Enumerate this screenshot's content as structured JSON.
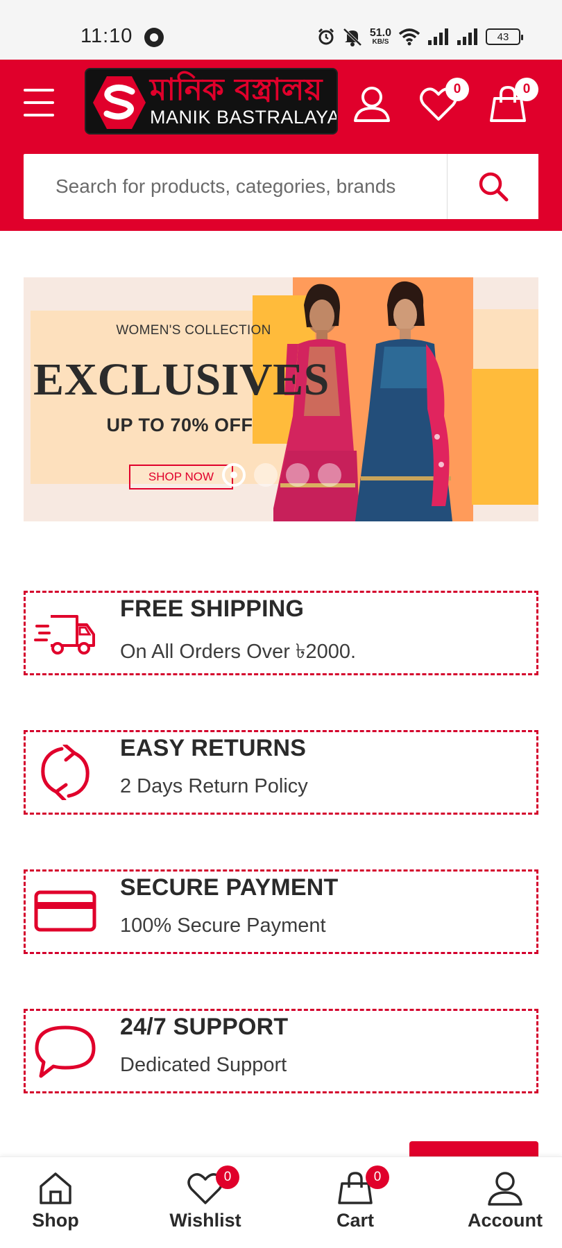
{
  "status_bar": {
    "time": "11:10",
    "net_speed_value": "51.0",
    "net_speed_unit": "KB/S",
    "battery": "43"
  },
  "header": {
    "logo_bengali": "মানিক বস্ত্রালয়",
    "logo_english": "MANIK BASTRALAYA",
    "wishlist_count": "0",
    "cart_count": "0",
    "accent_color": "#e0002b"
  },
  "search": {
    "placeholder": "Search for products, categories, brands"
  },
  "banner": {
    "subtitle": "WOMEN'S COLLECTION",
    "title": "EXCLUSIVES",
    "offer": "UP TO 70% OFF",
    "cta": "SHOP NOW",
    "slide_count": 4,
    "active_slide": 1
  },
  "features": [
    {
      "icon": "truck-icon",
      "title": "FREE SHIPPING",
      "subtitle": "On All Orders Over ৳2000."
    },
    {
      "icon": "refresh-icon",
      "title": "EASY RETURNS",
      "subtitle": "2 Days Return Policy"
    },
    {
      "icon": "credit-card-icon",
      "title": "SECURE PAYMENT",
      "subtitle": "100% Secure Payment"
    },
    {
      "icon": "chat-bubble-icon",
      "title": "24/7 SUPPORT",
      "subtitle": "Dedicated Support"
    }
  ],
  "bottom_nav": {
    "shop": "Shop",
    "wishlist": "Wishlist",
    "wishlist_count": "0",
    "cart": "Cart",
    "cart_count": "0",
    "account": "Account"
  }
}
